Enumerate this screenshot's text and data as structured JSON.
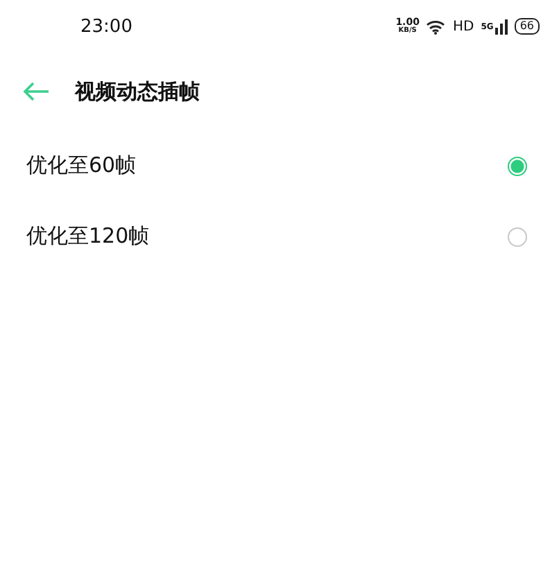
{
  "status_bar": {
    "time": "23:00",
    "speed": "1.00",
    "speed_unit": "KB/S",
    "network": "HD",
    "cell": "5G",
    "battery": "66"
  },
  "header": {
    "title": "视频动态插帧"
  },
  "options": [
    {
      "label": "优化至60帧",
      "selected": true
    },
    {
      "label": "优化至120帧",
      "selected": false
    }
  ]
}
